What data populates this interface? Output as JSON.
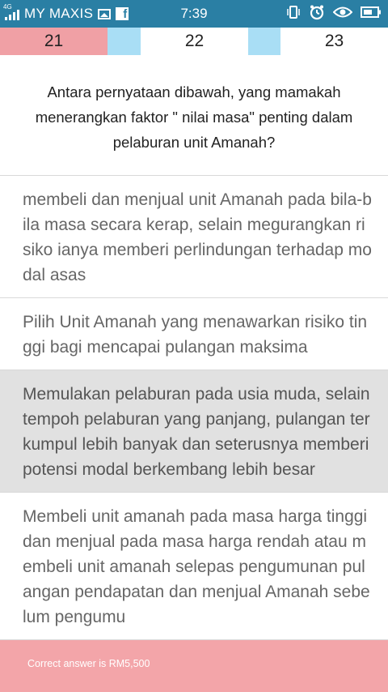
{
  "status_bar": {
    "network_tag": "4G",
    "carrier": "MY MAXIS",
    "time": "7:39",
    "left_icons": [
      "signal-icon",
      "image-icon",
      "facebook-icon"
    ],
    "right_icons": [
      "vibrate-icon",
      "alarm-icon",
      "eye-icon",
      "battery-icon"
    ]
  },
  "tabs": [
    {
      "label": "21",
      "color": "#f0a0a5"
    },
    {
      "label": "",
      "color": "#a9def5"
    },
    {
      "label": "22",
      "color": "#ffffff"
    },
    {
      "label": "",
      "color": "#a9def5"
    },
    {
      "label": "23",
      "color": "#ffffff"
    }
  ],
  "question": "Antara pernyataan dibawah, yang mamakah menerangkan faktor \" nilai masa\" penting dalam pelaburan unit Amanah?",
  "options": [
    {
      "text": "membeli dan menjual unit Amanah pada bila-bila masa secara kerap, selain megurangkan risiko ianya memberi perlindungan terhadap modal asas",
      "selected": false
    },
    {
      "text": "Pilih Unit Amanah yang menawarkan risiko tinggi bagi mencapai pulangan maksima",
      "selected": false
    },
    {
      "text": "Memulakan pelaburan pada usia muda, selain tempoh pelaburan yang panjang, pulangan terkumpul lebih banyak dan seterusnya memberi potensi modal berkembang lebih besar",
      "selected": true
    },
    {
      "text": "Membeli unit amanah pada masa harga tinggi dan menjual pada masa harga rendah atau membeli unit amanah selepas pengumunan pulangan pendapatan dan menjual Amanah sebelum pengumu",
      "selected": false
    }
  ],
  "footer": {
    "text": "Correct answer is RM5,500",
    "color": "#f0a0a5"
  }
}
